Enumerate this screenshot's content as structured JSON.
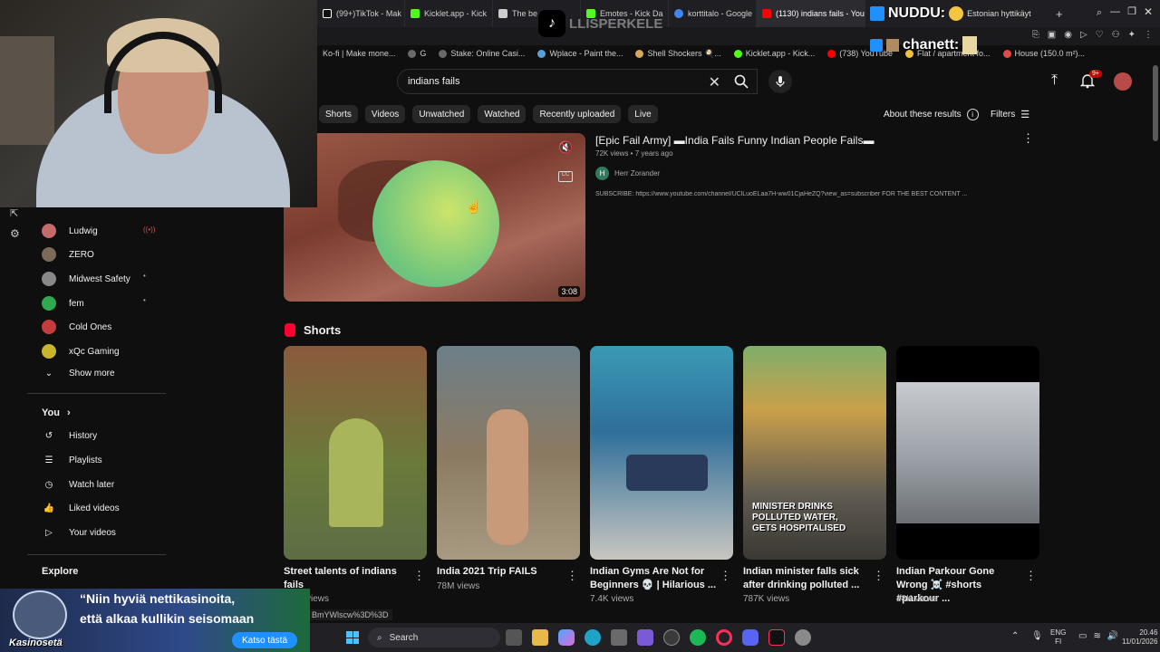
{
  "browser": {
    "tabs": [
      {
        "label": "(99+)TikTok - Mak",
        "color": "#ffffff"
      },
      {
        "label": "Kicklet.app - Kick",
        "color": "#53fc18"
      },
      {
        "label": "The be",
        "color": "#cccccc"
      },
      {
        "label": "Emotes - Kick Da",
        "color": "#53fc18"
      },
      {
        "label": "korttitalo - Google",
        "color": "#4285f4"
      },
      {
        "label": "(1130) indians fails - You",
        "color": "#ff0000"
      }
    ],
    "bookmarks": [
      "Ko-fi | Make mone...",
      "G",
      "Stake: Online Casi...",
      "Wplace - Paint the...",
      "Shell Shockers 🍳...",
      "Kicklet.app - Kick...",
      "(738) YouTube",
      "Flat / apartment fo...",
      "House (150.0 m²)..."
    ]
  },
  "overlay": {
    "channel_watermark": "LLISPERKELE",
    "chat_line_1": "NUDDU:",
    "chat_line_1_suffix": "Estonian hyttikäyt",
    "chat_line_2": "chanett:",
    "ad_quote_line1": "“Niin hyviä nettikasinoita,",
    "ad_quote_line2": "että alkaa kullikin seisomaan",
    "ad_button": "Katso tästä",
    "ad_brand": "Kasinosetä"
  },
  "search": {
    "query": "indians fails",
    "notifications_badge": "9+"
  },
  "chips": [
    "Shorts",
    "Videos",
    "Unwatched",
    "Watched",
    "Recently uploaded",
    "Live"
  ],
  "about_results": "About these results",
  "filters_label": "Filters",
  "sidebar": {
    "subscriptions": [
      {
        "name": "Ludwig",
        "badge": "((•))",
        "color": "#c56a6a"
      },
      {
        "name": "ZERO",
        "badge": "",
        "color": "#7b6a55"
      },
      {
        "name": "Midwest Safety",
        "badge": "•",
        "color": "#888888"
      },
      {
        "name": "fem",
        "badge": "•",
        "color": "#2fa84f"
      },
      {
        "name": "Cold Ones",
        "badge": "",
        "color": "#c53c3c"
      },
      {
        "name": "xQc Gaming",
        "badge": "",
        "color": "#c9b52b"
      }
    ],
    "show_more": "Show more",
    "you_label": "You",
    "you_items": [
      "History",
      "Playlists",
      "Watch later",
      "Liked videos",
      "Your videos"
    ],
    "explore_label": "Explore"
  },
  "video": {
    "title": "[Epic Fail Army] ▬India Fails Funny Indian People Fails▬",
    "meta": "72K views • 7 years ago",
    "channel": "Herr Zorander",
    "channel_initial": "H",
    "description": "SUBSCRIBE: https://www.youtube.com/channel/UClLuoELaa7H-ww01CjaHeZQ?view_as=subscriber FOR THE BEST CONTENT ...",
    "duration": "3:08"
  },
  "shorts": {
    "heading": "Shorts",
    "items": [
      {
        "title": "Street talents of indians fails",
        "views": "views",
        "caption": ""
      },
      {
        "title": "India 2021 Trip FAILS",
        "views": "78M views",
        "caption": ""
      },
      {
        "title": "Indian Gyms Are Not for Beginners 💀 | Hilarious ...",
        "views": "7.4K views",
        "caption": ""
      },
      {
        "title": "Indian minister falls sick after drinking polluted ...",
        "views": "787K views",
        "caption": "MINISTER DRINKS POLLUTED WATER, GETS HOSPITALISED"
      },
      {
        "title": "Indian Parkour Gone Wrong ☠️ #shorts #parkour ...",
        "views": "18K views",
        "caption": ""
      }
    ]
  },
  "status_url": "BmYWlscw%3D%3D",
  "taskbar": {
    "search_placeholder": "Search",
    "lang": "ENG",
    "region": "FI",
    "time": "20.46",
    "date": "11/01/2026"
  }
}
